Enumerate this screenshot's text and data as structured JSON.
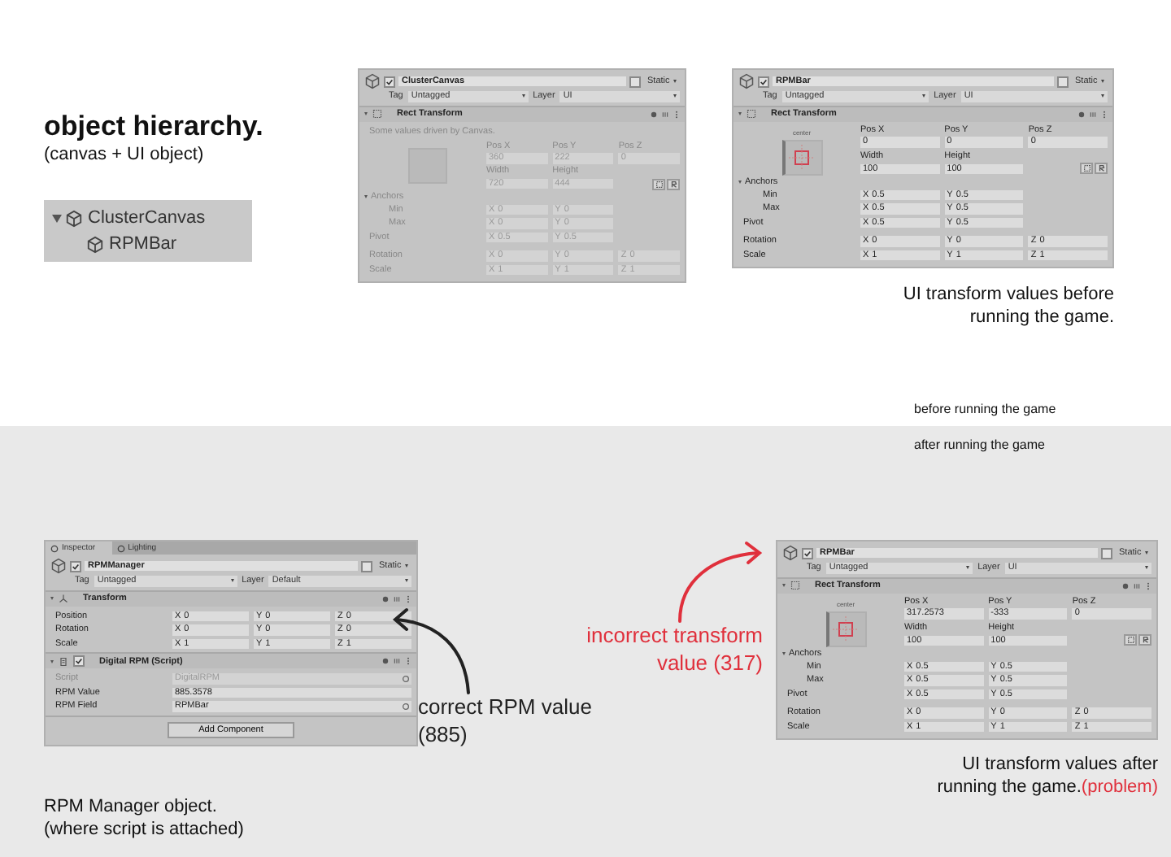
{
  "hierarchy_title": "object hierarchy.",
  "hierarchy_subtitle": "(canvas + UI object)",
  "hierarchy": [
    {
      "label": "ClusterCanvas",
      "expanded": true,
      "children": [
        {
          "label": "RPMBar"
        }
      ]
    }
  ],
  "phase_labels": [
    "before running the game",
    "after running the game"
  ],
  "panels": [
    {
      "name": "ClusterCanvas",
      "active": true,
      "static": false,
      "static_label": "Static",
      "tag_label": "Tag",
      "tag": "Untagged",
      "layer_label": "Layer",
      "layer": "UI",
      "components": [
        {
          "kind": "rect_transform",
          "title": "Rect Transform",
          "expanded": true,
          "driven": true,
          "note": "Some values driven by Canvas.",
          "position": [
            {
              "label": "Pos X",
              "value": "360"
            },
            {
              "label": "Pos Y",
              "value": "222"
            },
            {
              "label": "Pos Z",
              "value": "0"
            }
          ],
          "size": [
            {
              "label": "Width",
              "value": "720"
            },
            {
              "label": "Height",
              "value": "444"
            }
          ],
          "anchors": {
            "label": "Anchors",
            "expanded": true,
            "rows": [
              {
                "label": "Min",
                "values": [
                  {
                    "axis": "X",
                    "value": "0"
                  },
                  {
                    "axis": "Y",
                    "value": "0"
                  }
                ]
              },
              {
                "label": "Max",
                "values": [
                  {
                    "axis": "X",
                    "value": "0"
                  },
                  {
                    "axis": "Y",
                    "value": "0"
                  }
                ]
              }
            ]
          },
          "rows": [
            {
              "label": "Pivot",
              "values": [
                {
                  "axis": "X",
                  "value": "0.5"
                },
                {
                  "axis": "Y",
                  "value": "0.5"
                }
              ]
            },
            {
              "label": "Rotation",
              "values": [
                {
                  "axis": "X",
                  "value": "0"
                },
                {
                  "axis": "Y",
                  "value": "0"
                },
                {
                  "axis": "Z",
                  "value": "0"
                }
              ]
            },
            {
              "label": "Scale",
              "values": [
                {
                  "axis": "X",
                  "value": "1"
                },
                {
                  "axis": "Y",
                  "value": "1"
                },
                {
                  "axis": "Z",
                  "value": "1"
                }
              ]
            }
          ]
        }
      ]
    },
    {
      "name": "RPMBar",
      "active": true,
      "static": false,
      "static_label": "Static",
      "tag_label": "Tag",
      "tag": "Untagged",
      "layer_label": "Layer",
      "layer": "UI",
      "components": [
        {
          "kind": "rect_transform",
          "title": "Rect Transform",
          "expanded": true,
          "driven": false,
          "preset_label": "center",
          "position": [
            {
              "label": "Pos X",
              "value": "0"
            },
            {
              "label": "Pos Y",
              "value": "0"
            },
            {
              "label": "Pos Z",
              "value": "0"
            }
          ],
          "size": [
            {
              "label": "Width",
              "value": "100"
            },
            {
              "label": "Height",
              "value": "100"
            }
          ],
          "anchors": {
            "label": "Anchors",
            "expanded": true,
            "rows": [
              {
                "label": "Min",
                "values": [
                  {
                    "axis": "X",
                    "value": "0.5"
                  },
                  {
                    "axis": "Y",
                    "value": "0.5"
                  }
                ]
              },
              {
                "label": "Max",
                "values": [
                  {
                    "axis": "X",
                    "value": "0.5"
                  },
                  {
                    "axis": "Y",
                    "value": "0.5"
                  }
                ]
              }
            ]
          },
          "rows": [
            {
              "label": "Pivot",
              "values": [
                {
                  "axis": "X",
                  "value": "0.5"
                },
                {
                  "axis": "Y",
                  "value": "0.5"
                }
              ]
            },
            {
              "label": "Rotation",
              "values": [
                {
                  "axis": "X",
                  "value": "0"
                },
                {
                  "axis": "Y",
                  "value": "0"
                },
                {
                  "axis": "Z",
                  "value": "0"
                }
              ]
            },
            {
              "label": "Scale",
              "values": [
                {
                  "axis": "X",
                  "value": "1"
                },
                {
                  "axis": "Y",
                  "value": "1"
                },
                {
                  "axis": "Z",
                  "value": "1"
                }
              ]
            }
          ]
        }
      ]
    },
    {
      "tabs": [
        {
          "label": "Inspector",
          "selected": true
        },
        {
          "label": "Lighting",
          "selected": false
        }
      ],
      "name": "RPMManager",
      "active": true,
      "static": false,
      "static_label": "Static",
      "tag_label": "Tag",
      "tag": "Untagged",
      "layer_label": "Layer",
      "layer": "Default",
      "components": [
        {
          "kind": "transform",
          "title": "Transform",
          "expanded": true,
          "rows": [
            {
              "label": "Position",
              "values": [
                {
                  "axis": "X",
                  "value": "0"
                },
                {
                  "axis": "Y",
                  "value": "0"
                },
                {
                  "axis": "Z",
                  "value": "0"
                }
              ]
            },
            {
              "label": "Rotation",
              "values": [
                {
                  "axis": "X",
                  "value": "0"
                },
                {
                  "axis": "Y",
                  "value": "0"
                },
                {
                  "axis": "Z",
                  "value": "0"
                }
              ]
            },
            {
              "label": "Scale",
              "values": [
                {
                  "axis": "X",
                  "value": "1"
                },
                {
                  "axis": "Y",
                  "value": "1"
                },
                {
                  "axis": "Z",
                  "value": "1"
                }
              ]
            }
          ]
        },
        {
          "kind": "script",
          "title": "Digital RPM (Script)",
          "expanded": true,
          "enabled": true,
          "fields": [
            {
              "label": "Script",
              "value": "DigitalRPM",
              "kind": "object",
              "disabled": true
            },
            {
              "label": "RPM Value",
              "value": "885.3578",
              "kind": "number",
              "disabled": false
            },
            {
              "label": "RPM Field",
              "value": "RPMBar",
              "kind": "object",
              "disabled": false
            }
          ]
        }
      ],
      "add_component": "Add Component"
    },
    {
      "name": "RPMBar",
      "active": true,
      "static": false,
      "static_label": "Static",
      "tag_label": "Tag",
      "tag": "Untagged",
      "layer_label": "Layer",
      "layer": "UI",
      "components": [
        {
          "kind": "rect_transform",
          "title": "Rect Transform",
          "expanded": true,
          "driven": false,
          "preset_label": "center",
          "position": [
            {
              "label": "Pos X",
              "value": "317.2573"
            },
            {
              "label": "Pos Y",
              "value": "-333"
            },
            {
              "label": "Pos Z",
              "value": "0"
            }
          ],
          "size": [
            {
              "label": "Width",
              "value": "100"
            },
            {
              "label": "Height",
              "value": "100"
            }
          ],
          "anchors": {
            "label": "Anchors",
            "expanded": true,
            "rows": [
              {
                "label": "Min",
                "values": [
                  {
                    "axis": "X",
                    "value": "0.5"
                  },
                  {
                    "axis": "Y",
                    "value": "0.5"
                  }
                ]
              },
              {
                "label": "Max",
                "values": [
                  {
                    "axis": "X",
                    "value": "0.5"
                  },
                  {
                    "axis": "Y",
                    "value": "0.5"
                  }
                ]
              }
            ]
          },
          "rows": [
            {
              "label": "Pivot",
              "values": [
                {
                  "axis": "X",
                  "value": "0.5"
                },
                {
                  "axis": "Y",
                  "value": "0.5"
                }
              ]
            },
            {
              "label": "Rotation",
              "values": [
                {
                  "axis": "X",
                  "value": "0"
                },
                {
                  "axis": "Y",
                  "value": "0"
                },
                {
                  "axis": "Z",
                  "value": "0"
                }
              ]
            },
            {
              "label": "Scale",
              "values": [
                {
                  "axis": "X",
                  "value": "1"
                },
                {
                  "axis": "Y",
                  "value": "1"
                },
                {
                  "axis": "Z",
                  "value": "1"
                }
              ]
            }
          ]
        }
      ]
    }
  ],
  "captions": [
    {
      "lines": [
        "UI transform values before",
        "running the game."
      ]
    },
    {
      "lines": [
        "RPM Manager object.",
        "(where script is attached)"
      ]
    },
    {
      "lines": [
        "UI transform values after",
        "running the game."
      ],
      "note": "(problem)"
    }
  ],
  "annotations": [
    {
      "kind": "incorrect",
      "lines": [
        "incorrect transform",
        "value (317)"
      ]
    },
    {
      "kind": "correct",
      "lines": [
        "correct RPM value",
        "(885)"
      ]
    }
  ]
}
